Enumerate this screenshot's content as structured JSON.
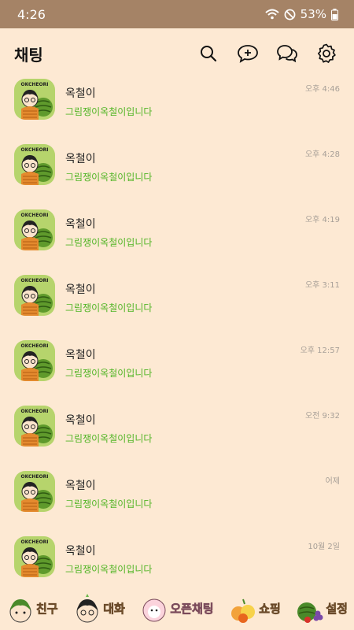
{
  "status": {
    "time": "4:26",
    "battery": "53%"
  },
  "header": {
    "title": "채팅",
    "actions": [
      "search-icon",
      "new-chat-icon",
      "open-chat-icon",
      "settings-icon"
    ]
  },
  "chats": [
    {
      "avatar_text": "OKCHEORI",
      "name": "옥철이",
      "preview": "그림쟁이옥철이입니다",
      "time": "오후 4:46"
    },
    {
      "avatar_text": "OKCHEORI",
      "name": "옥철이",
      "preview": "그림쟁이옥철이입니다",
      "time": "오후 4:28"
    },
    {
      "avatar_text": "OKCHEORI",
      "name": "옥철이",
      "preview": "그림쟁이옥철이입니다",
      "time": "오후 4:19"
    },
    {
      "avatar_text": "OKCHEORI",
      "name": "옥철이",
      "preview": "그림쟁이옥철이입니다",
      "time": "오후 3:11"
    },
    {
      "avatar_text": "OKCHEORI",
      "name": "옥철이",
      "preview": "그림쟁이옥철이입니다",
      "time": "오후 12:57"
    },
    {
      "avatar_text": "OKCHEORI",
      "name": "옥철이",
      "preview": "그림쟁이옥철이입니다",
      "time": "오전 9:32"
    },
    {
      "avatar_text": "OKCHEORI",
      "name": "옥철이",
      "preview": "그림쟁이옥철이입니다",
      "time": "어제"
    },
    {
      "avatar_text": "OKCHEORI",
      "name": "옥철이",
      "preview": "그림쟁이옥철이입니다",
      "time": "10월 2일"
    }
  ],
  "tabs": [
    {
      "label": "친구",
      "icon": "friends-character-icon"
    },
    {
      "label": "대화",
      "icon": "chats-character-icon"
    },
    {
      "label": "오픈채팅",
      "icon": "openchat-character-icon"
    },
    {
      "label": "쇼핑",
      "icon": "shopping-fruit-icon"
    },
    {
      "label": "설정",
      "icon": "settings-fruit-icon"
    }
  ],
  "colors": {
    "status_bar": "#a58366",
    "background": "#fde9d3",
    "preview_text": "#52b526",
    "avatar_bg": "#b6d46c"
  }
}
